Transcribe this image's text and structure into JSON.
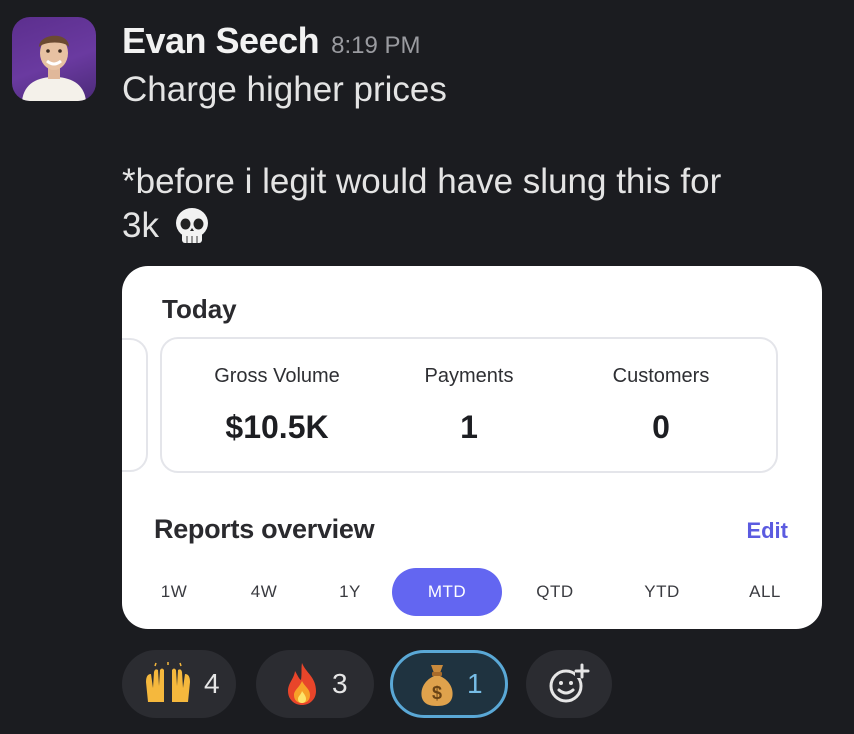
{
  "message": {
    "sender": "Evan Seech",
    "time": "8:19 PM",
    "lines": [
      "Charge higher prices",
      "*before i legit would have slung this for",
      "3k"
    ],
    "avatar_icon": "person-photo-icon",
    "trailing_emoji_icon": "skull-icon"
  },
  "card": {
    "section_title": "Today",
    "stats": [
      {
        "label": "Gross Volume",
        "value": "$10.5K"
      },
      {
        "label": "Payments",
        "value": "1"
      },
      {
        "label": "Customers",
        "value": "0"
      }
    ],
    "reports_title": "Reports overview",
    "edit_label": "Edit",
    "ranges": [
      "1W",
      "4W",
      "1Y",
      "MTD",
      "QTD",
      "YTD",
      "ALL"
    ],
    "active_range": "MTD",
    "accent_color": "#6366f1"
  },
  "reactions": [
    {
      "icon": "raising-hands-icon",
      "count": "4",
      "selected": false
    },
    {
      "icon": "fire-icon",
      "count": "3",
      "selected": false
    },
    {
      "icon": "money-bag-icon",
      "count": "1",
      "selected": true
    },
    {
      "icon": "add-reaction-icon",
      "count": null,
      "selected": false
    }
  ]
}
